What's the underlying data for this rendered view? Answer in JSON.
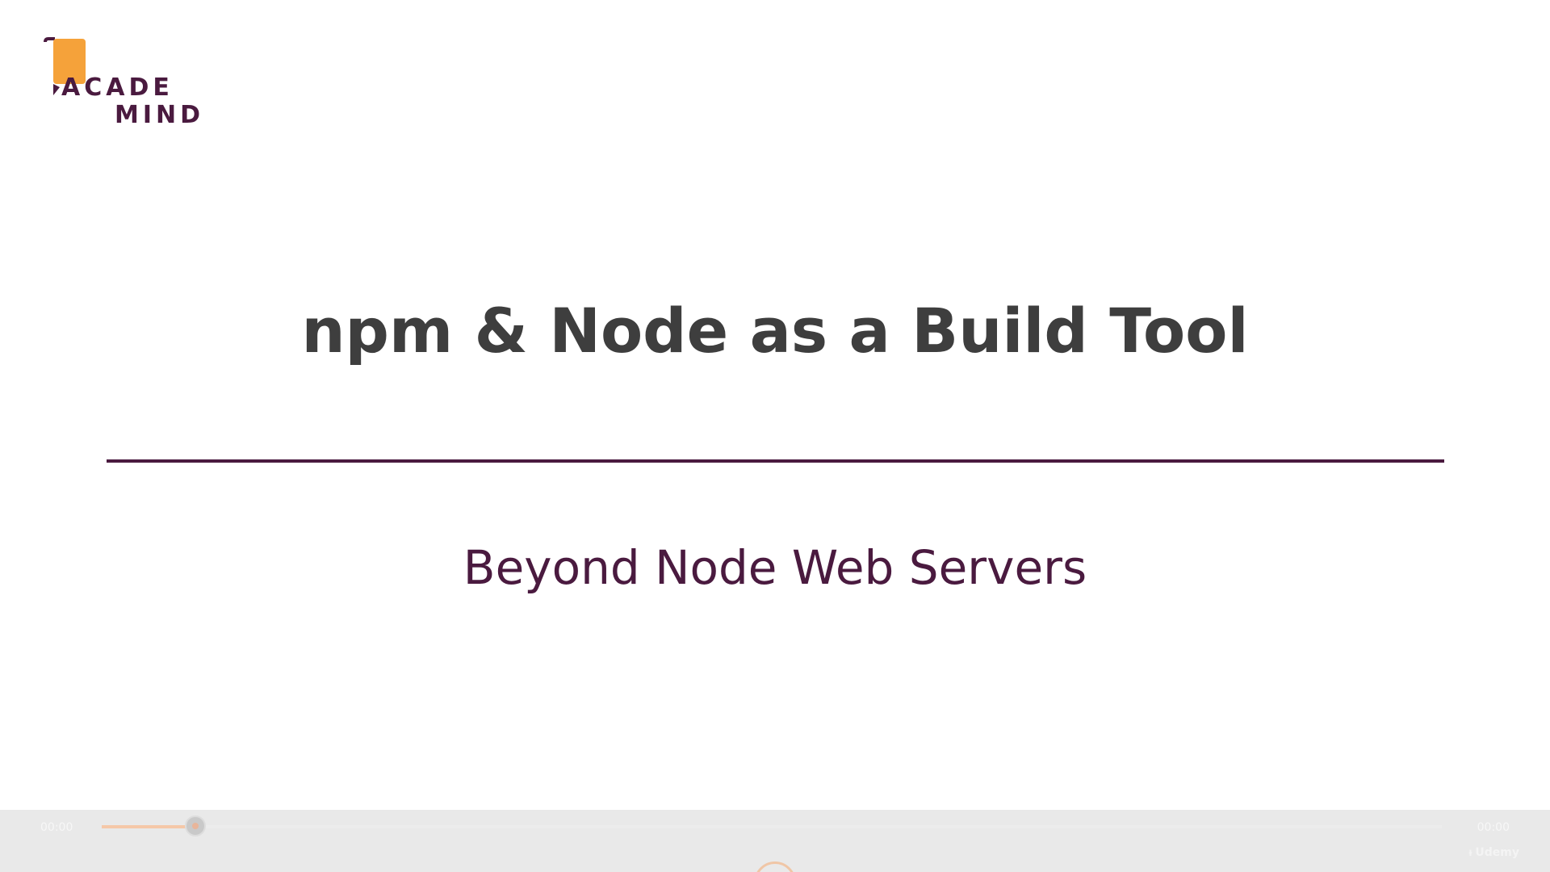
{
  "logo": {
    "line1": "ACADE",
    "line2": "MIND",
    "brand_color": "#4a1a3f",
    "accent_color": "#f5a23a"
  },
  "slide": {
    "title": "npm & Node as a Build Tool",
    "subtitle": "Beyond Node Web Servers",
    "title_color": "#3e3e3e",
    "subtitle_color": "#4a1a3f"
  },
  "player": {
    "time_elapsed": "00:00",
    "time_total": "00:00",
    "progress_fraction": 0.07,
    "watermark": "Udemy"
  }
}
